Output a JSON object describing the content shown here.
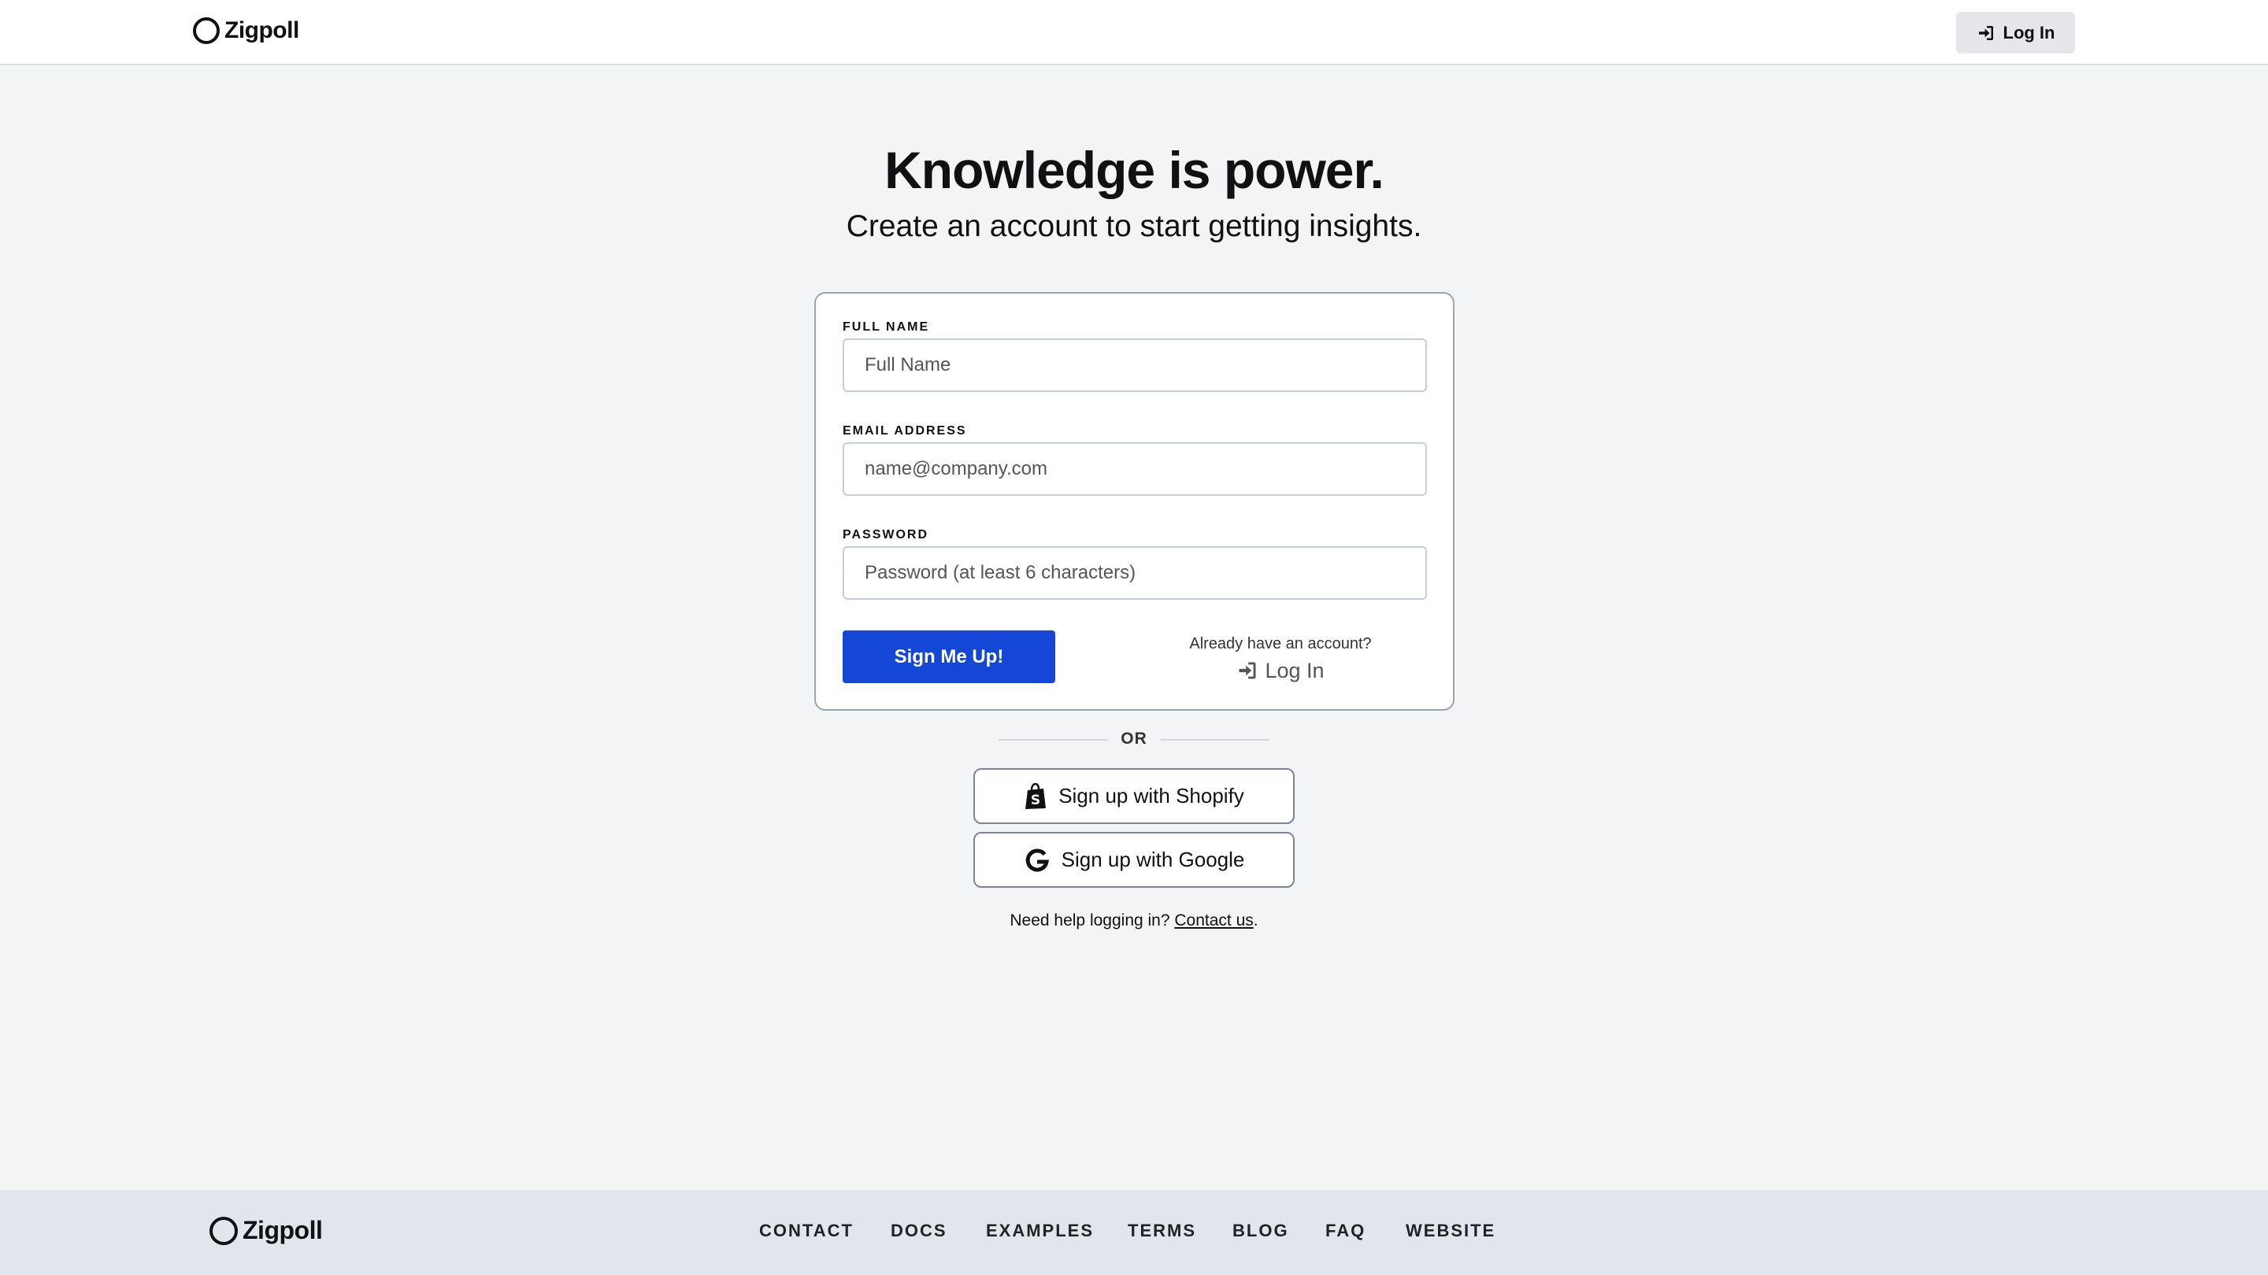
{
  "header": {
    "brand": "Zigpoll",
    "login_label": "Log In"
  },
  "hero": {
    "title": "Knowledge is power.",
    "subtitle": "Create an account to start getting insights."
  },
  "form": {
    "full_name": {
      "label": "FULL NAME",
      "placeholder": "Full Name",
      "value": ""
    },
    "email": {
      "label": "EMAIL ADDRESS",
      "placeholder": "name@company.com",
      "value": ""
    },
    "password": {
      "label": "PASSWORD",
      "placeholder": "Password (at least 6 characters)",
      "value": ""
    },
    "submit_label": "Sign Me Up!",
    "already_text": "Already have an account?",
    "login_label": "Log In"
  },
  "divider": {
    "text": "OR"
  },
  "social": {
    "shopify_label": "Sign up with Shopify",
    "google_label": "Sign up with Google"
  },
  "help": {
    "text": "Need help logging in?",
    "link": "Contact us",
    "suffix": "."
  },
  "footer": {
    "brand": "Zigpoll",
    "nav": {
      "contact": "CONTACT",
      "docs": "DOCS",
      "examples": "EXAMPLES",
      "terms": "TERMS",
      "blog": "BLOG",
      "faq": "FAQ",
      "website": "WEBSITE"
    }
  },
  "colors": {
    "primary": "#1447d6",
    "background": "#f3f4f6",
    "footer_bg": "#e2e6ec"
  }
}
